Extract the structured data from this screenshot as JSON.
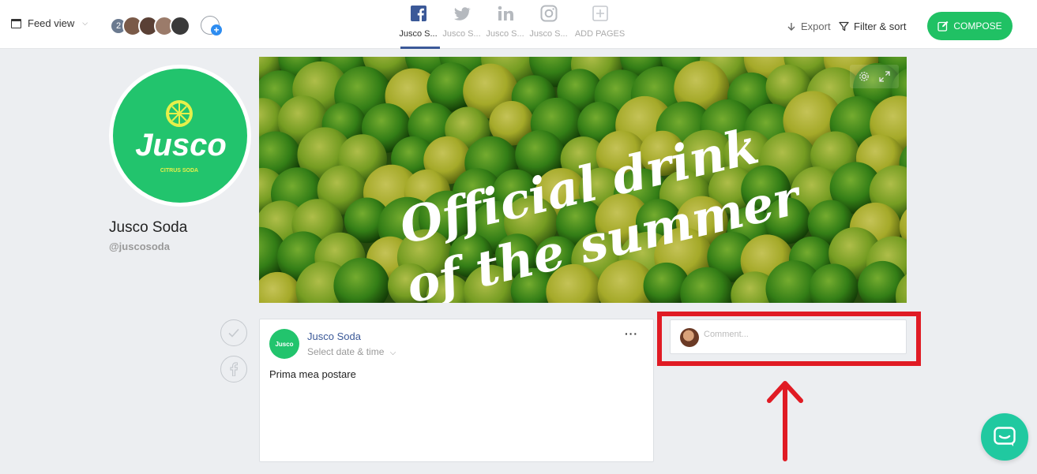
{
  "topbar": {
    "feed_view_label": "Feed view",
    "team_count": "2",
    "tabs": [
      {
        "label": "Jusco S...",
        "icon": "facebook-icon",
        "active": true
      },
      {
        "label": "Jusco S...",
        "icon": "twitter-icon",
        "active": false
      },
      {
        "label": "Jusco S...",
        "icon": "linkedin-icon",
        "active": false
      },
      {
        "label": "Jusco S...",
        "icon": "instagram-icon",
        "active": false
      },
      {
        "label": "ADD PAGES",
        "icon": "plus-square-icon",
        "active": false
      }
    ],
    "export_label": "Export",
    "filter_label": "Filter & sort",
    "compose_label": "COMPOSE"
  },
  "profile": {
    "logo_text": "Jusco",
    "logo_tagline": "CITRUS SODA",
    "name": "Jusco Soda",
    "handle": "@juscosoda"
  },
  "cover": {
    "line1": "Official drink",
    "line2": "of the summer"
  },
  "post": {
    "avatar_text": "Jusco",
    "author": "Jusco Soda",
    "date_placeholder": "Select date & time",
    "more": "···",
    "text": "Prima mea postare"
  },
  "comment": {
    "placeholder": "Comment..."
  },
  "colors": {
    "brand_green": "#22c46d",
    "compose_green": "#20c164",
    "facebook_blue": "#3b5998",
    "annotation_red": "#e01b24",
    "chat_teal": "#20c9a0"
  }
}
